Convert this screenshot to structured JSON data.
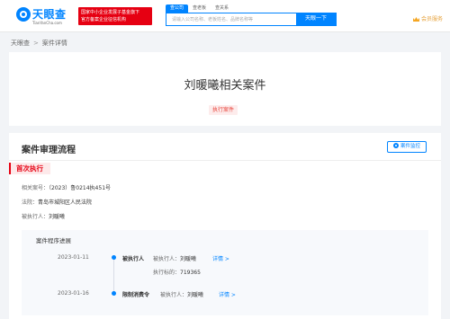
{
  "header": {
    "logo_text": "天眼查",
    "logo_sub": "TianYanCha.com",
    "badge_line1": "国家中小企业发展子基金旗下",
    "badge_line2": "官方备案企业征信机构",
    "search_tabs": [
      "查公司",
      "查老板",
      "查关系"
    ],
    "search_placeholder": "请输入公司名称、老板姓名、品牌名称等",
    "search_button": "天眼一下",
    "vip_label": "会员服务"
  },
  "breadcrumb": {
    "home": "天眼查",
    "separator": ">",
    "current": "案件详情"
  },
  "title_card": {
    "title": "刘暖曦相关案件",
    "tag": "执行案件"
  },
  "process": {
    "section_title": "案件审理流程",
    "monitor_button": "案件监控",
    "stage": "首次执行",
    "info": {
      "case_no_label": "相关案号：",
      "case_no": "（2023）鲁0214执451号",
      "court_label": "法院：",
      "court": "青岛市城阳区人民法院",
      "executed_label": "被执行人：",
      "executed": "刘暖曦"
    },
    "progress_title": "案件程序进展",
    "timeline": [
      {
        "date": "2023-01-11",
        "event": "被执行人",
        "detail_label": "被执行人：",
        "detail_value": "刘暖曦",
        "link": "详情 >",
        "extra_label": "执行标的：",
        "extra_value": "719365"
      },
      {
        "date": "2023-01-16",
        "event": "限制消费令",
        "detail_label": "被执行人：",
        "detail_value": "刘暖曦",
        "link": "详情 >"
      }
    ]
  }
}
